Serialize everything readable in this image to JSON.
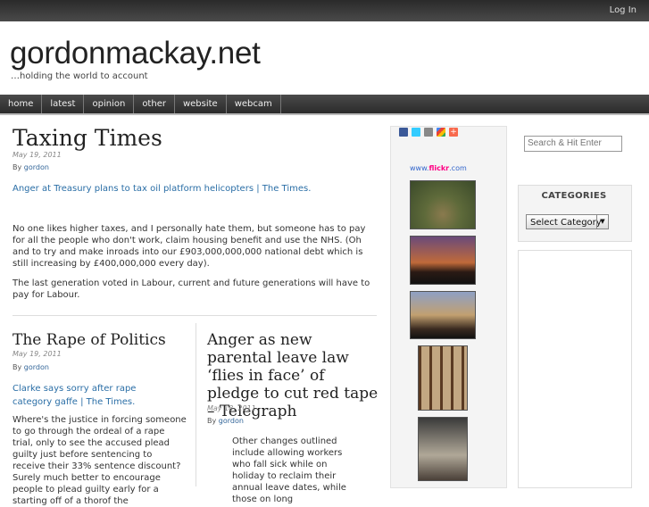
{
  "topbar": {
    "login": "Log In"
  },
  "site": {
    "title": "gordonmackay.net",
    "tagline": "…holding the world to account"
  },
  "nav": {
    "items": [
      "home",
      "latest",
      "opinion",
      "other",
      "website",
      "webcam"
    ]
  },
  "posts": {
    "main": {
      "title": "Taxing Times",
      "date": "May 19, 2011",
      "by": "By",
      "author": "gordon",
      "link": "Anger at Treasury plans to tax oil platform helicopters | The Times.",
      "para1": "No one likes higher taxes, and I personally hate them, but someone has to pay for all the people who don't work, claim housing benefit and use the NHS. (Oh and to try and make inroads into our £903,000,000,000 national debt which is still increasing by £400,000,000 every day).",
      "para2": "The last generation voted in Labour, current and future generations will have to pay for Labour."
    },
    "left": {
      "title": "The Rape of Politics",
      "date": "May 19, 2011",
      "by": "By",
      "author": "gordon",
      "link": "Clarke says sorry after rape category gaffe | The Times.",
      "para": "Where's the justice in forcing someone to go through the ordeal of a rape trial, only to see the accused plead guilty just before sentencing to receive their 33% sentence discount?  Surely much better to encourage people to plead guilty early for a starting off of a thorof the"
    },
    "right": {
      "title": "Anger as new parental leave law ‘flies in face’ of pledge to cut red tape – Telegraph",
      "date": "May 18, 2011",
      "by": "By",
      "author": "gordon",
      "para": "Other changes outlined include allowing workers who fall sick while on holiday to reclaim their annual leave dates, while those on long"
    }
  },
  "sidebar": {
    "flickr_prefix": "www.",
    "flickr_brand": "flickr",
    "flickr_suffix": ".com",
    "search_placeholder": "Search & Hit Enter",
    "categories_title": "CATEGORIES",
    "categories_select": "Select Category"
  },
  "share_icons": [
    "facebook-icon",
    "twitter-icon",
    "print-icon",
    "google-icon",
    "addthis-icon"
  ],
  "colors": {
    "link": "#2a6ea6",
    "nav": "#3a3a3a"
  }
}
